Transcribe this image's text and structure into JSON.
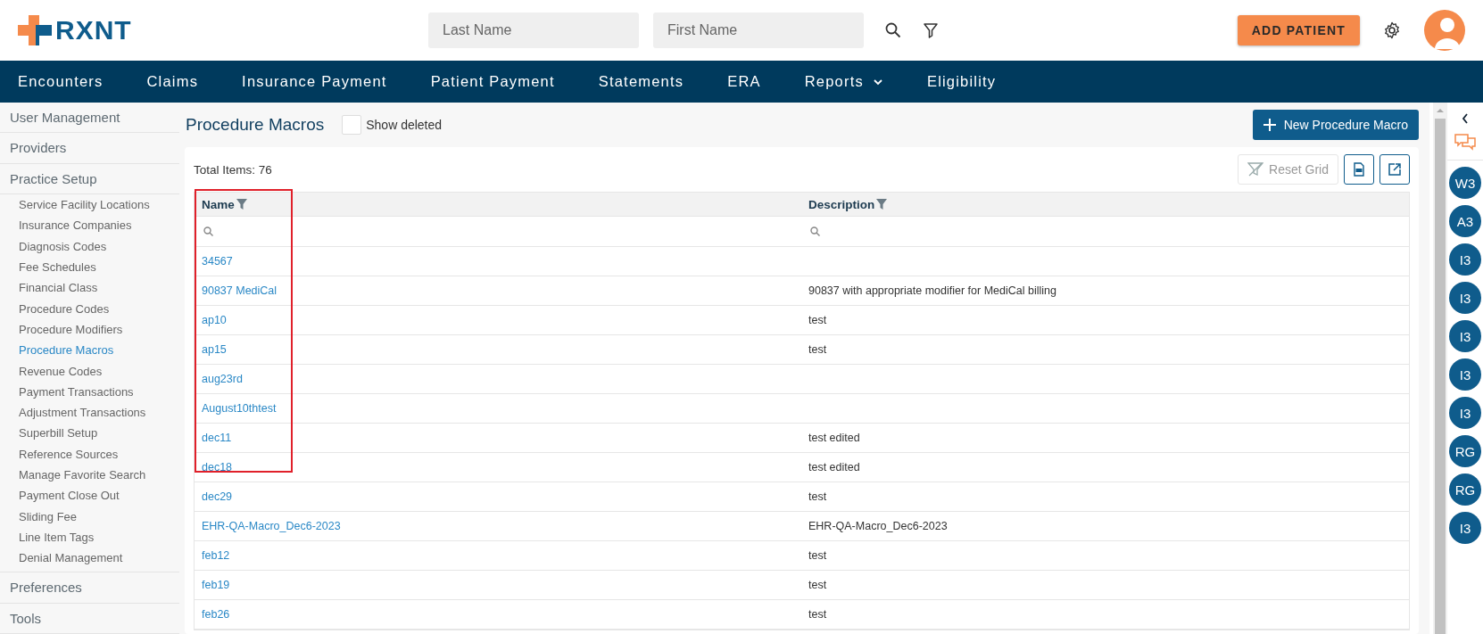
{
  "brand": {
    "name": "RXNT"
  },
  "search": {
    "last_name_placeholder": "Last Name",
    "first_name_placeholder": "First Name"
  },
  "add_patient": "ADD PATIENT",
  "nav": [
    {
      "label": "Encounters",
      "dropdown": false
    },
    {
      "label": "Claims",
      "dropdown": false
    },
    {
      "label": "Insurance Payment",
      "dropdown": false
    },
    {
      "label": "Patient Payment",
      "dropdown": false
    },
    {
      "label": "Statements",
      "dropdown": false
    },
    {
      "label": "ERA",
      "dropdown": false
    },
    {
      "label": "Reports",
      "dropdown": true
    },
    {
      "label": "Eligibility",
      "dropdown": false
    }
  ],
  "sidebar": [
    {
      "label": "User Management"
    },
    {
      "label": "Providers"
    },
    {
      "label": "Practice Setup",
      "children": [
        {
          "label": "Service Facility Locations",
          "selected": false
        },
        {
          "label": "Insurance Companies",
          "selected": false
        },
        {
          "label": "Diagnosis Codes",
          "selected": false
        },
        {
          "label": "Fee Schedules",
          "selected": false
        },
        {
          "label": "Financial Class",
          "selected": false
        },
        {
          "label": "Procedure Codes",
          "selected": false
        },
        {
          "label": "Procedure Modifiers",
          "selected": false
        },
        {
          "label": "Procedure Macros",
          "selected": true
        },
        {
          "label": "Revenue Codes",
          "selected": false
        },
        {
          "label": "Payment Transactions",
          "selected": false
        },
        {
          "label": "Adjustment Transactions",
          "selected": false
        },
        {
          "label": "Superbill Setup",
          "selected": false
        },
        {
          "label": "Reference Sources",
          "selected": false
        },
        {
          "label": "Manage Favorite Search",
          "selected": false
        },
        {
          "label": "Payment Close Out",
          "selected": false
        },
        {
          "label": "Sliding Fee",
          "selected": false
        },
        {
          "label": "Line Item Tags",
          "selected": false
        },
        {
          "label": "Denial Management",
          "selected": false
        }
      ]
    },
    {
      "label": "Preferences"
    },
    {
      "label": "Tools"
    }
  ],
  "page": {
    "title": "Procedure Macros",
    "show_deleted": {
      "label": "Show deleted",
      "checked": false
    },
    "new_button": "New Procedure Macro"
  },
  "grid": {
    "total": "Total Items: 76",
    "reset": "Reset Grid",
    "columns": [
      "Name",
      "Description"
    ],
    "rows": [
      {
        "name": "34567",
        "description": ""
      },
      {
        "name": "90837 MediCal",
        "description": "90837 with appropriate modifier for MediCal billing"
      },
      {
        "name": "ap10",
        "description": "test"
      },
      {
        "name": "ap15",
        "description": "test"
      },
      {
        "name": "aug23rd",
        "description": ""
      },
      {
        "name": "August10thtest",
        "description": ""
      },
      {
        "name": "dec11",
        "description": "test edited"
      },
      {
        "name": "dec18",
        "description": "test edited"
      },
      {
        "name": "dec29",
        "description": "test"
      },
      {
        "name": "EHR-QA-Macro_Dec6-2023",
        "description": "EHR-QA-Macro_Dec6-2023"
      },
      {
        "name": "feb12",
        "description": "test"
      },
      {
        "name": "feb19",
        "description": "test"
      },
      {
        "name": "feb26",
        "description": "test"
      }
    ]
  },
  "rail": {
    "avatars": [
      "W3",
      "A3",
      "I3",
      "I3",
      "I3",
      "I3",
      "I3",
      "RG",
      "RG",
      "I3"
    ]
  }
}
